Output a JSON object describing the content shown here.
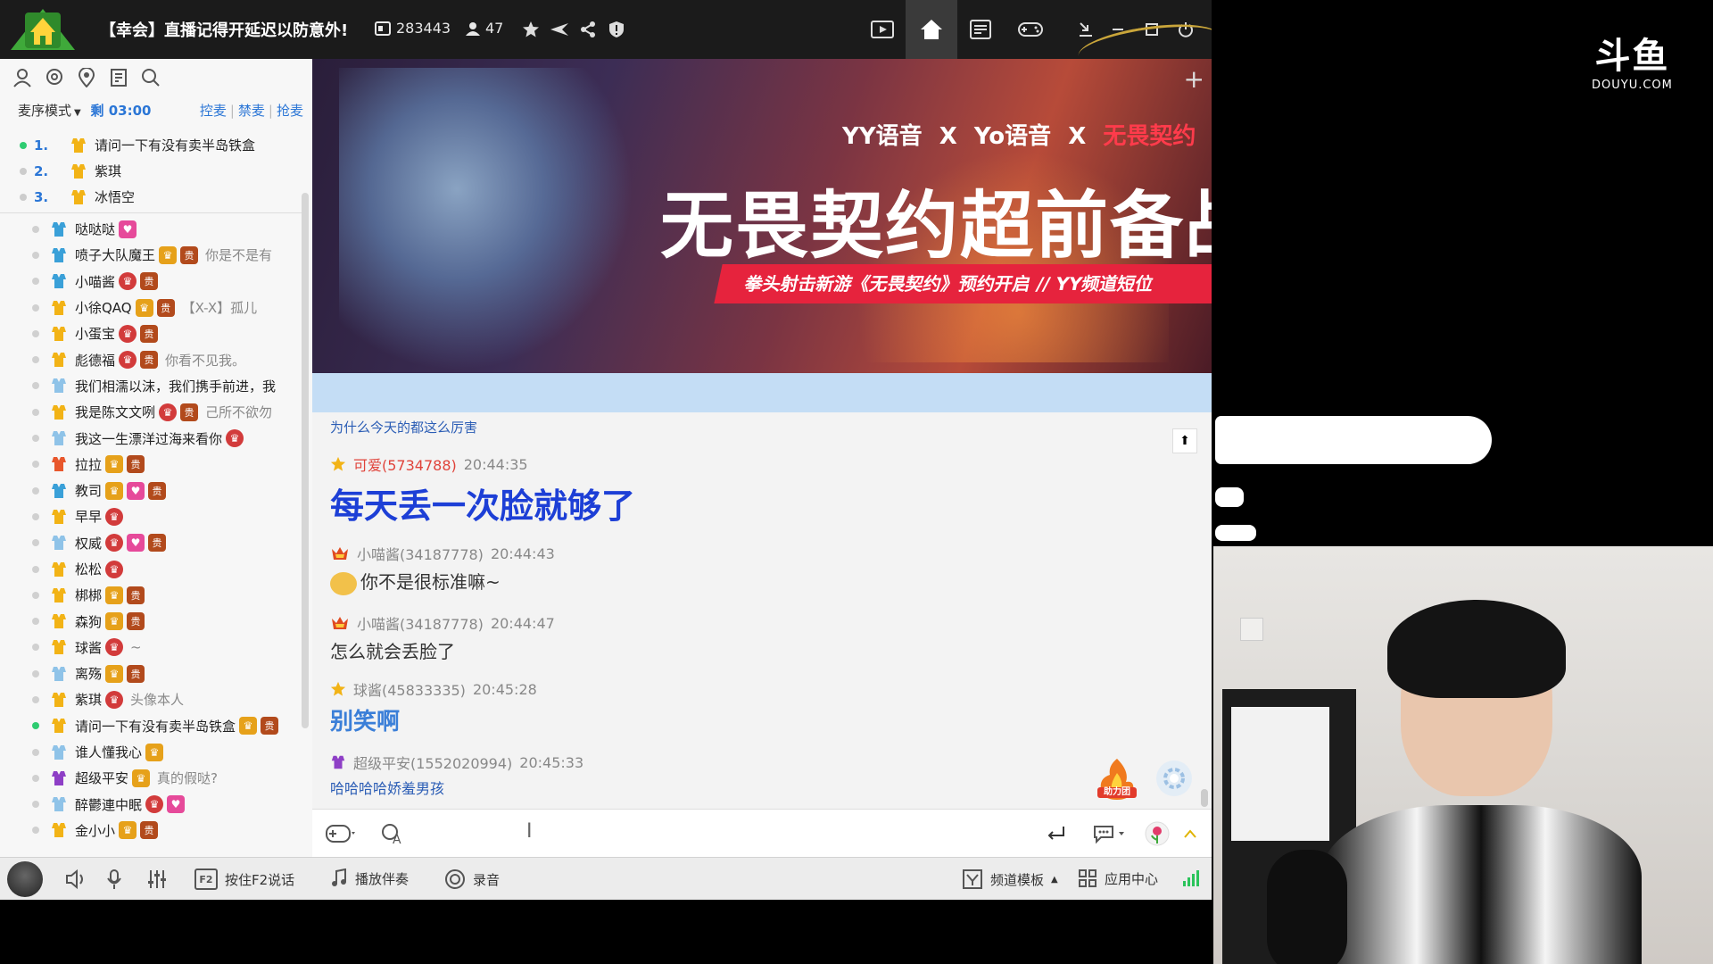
{
  "titlebar": {
    "title": "【幸会】直播记得开延迟以防意外!",
    "channel_id": "283443",
    "online_count": "47"
  },
  "left": {
    "mode_label": "麦序模式",
    "remaining": "剩 03:00",
    "links": [
      "控麦",
      "禁麦",
      "抢麦"
    ],
    "queue": [
      {
        "num": "1.",
        "name": "请问一下有没有卖半岛铁盒",
        "active": true
      },
      {
        "num": "2.",
        "name": "紫琪",
        "active": false
      },
      {
        "num": "3.",
        "name": "冰悟空",
        "active": false
      }
    ],
    "users": [
      {
        "name": "哒哒哒",
        "msg": ""
      },
      {
        "name": "喷子大队魔王",
        "msg": "你是不是有"
      },
      {
        "name": "小喵酱",
        "msg": ""
      },
      {
        "name": "小徐QAQ",
        "msg": "【X-X】孤儿"
      },
      {
        "name": "小蛋宝",
        "msg": ""
      },
      {
        "name": "彪德福",
        "msg": "你看不见我。"
      },
      {
        "name": "我们相濡以沫，我们携手前进，我",
        "msg": ""
      },
      {
        "name": "我是陈文文咧",
        "msg": "己所不欲勿"
      },
      {
        "name": "我这一生漂洋过海来看你",
        "msg": ""
      },
      {
        "name": "拉拉",
        "msg": ""
      },
      {
        "name": "教司",
        "msg": ""
      },
      {
        "name": "早早",
        "msg": ""
      },
      {
        "name": "权威",
        "msg": ""
      },
      {
        "name": "松松",
        "msg": ""
      },
      {
        "name": "梆梆",
        "msg": ""
      },
      {
        "name": "森狗",
        "msg": ""
      },
      {
        "name": "球酱",
        "msg": "~"
      },
      {
        "name": "离殇",
        "msg": ""
      },
      {
        "name": "紫琪",
        "msg": "头像本人"
      },
      {
        "name": "请问一下有没有卖半岛铁盒",
        "msg": ""
      },
      {
        "name": "谁人懂我心",
        "msg": ""
      },
      {
        "name": "超级平安",
        "msg": "真的假哒?"
      },
      {
        "name": "醉鬱連中眠",
        "msg": ""
      },
      {
        "name": "金小小",
        "msg": ""
      }
    ]
  },
  "banner": {
    "sponsor_a": "YY语音",
    "sponsor_x": "X",
    "sponsor_b": "Yo语音",
    "sponsor_c": "无畏契约",
    "title": "无畏契约超前备战",
    "strip": "拳头射击新游《无畏契约》预约开启 // YY频道短位"
  },
  "chat": {
    "top_text": "为什么今天的都这么厉害",
    "messages": [
      {
        "name": "可爱(5734788)",
        "time": "20:44:35",
        "text": "每天丢一次脸就够了",
        "style": "big",
        "name_style": "red"
      },
      {
        "name": "小喵酱(34187778)",
        "time": "20:44:43",
        "text": "你不是很标准嘛~",
        "style": "normal",
        "name_style": ""
      },
      {
        "name": "小喵酱(34187778)",
        "time": "20:44:47",
        "text": "怎么就会丢脸了",
        "style": "normal",
        "name_style": ""
      },
      {
        "name": "球酱(45833335)",
        "time": "20:45:28",
        "text": "别笑啊",
        "style": "blue",
        "name_style": ""
      },
      {
        "name": "超级平安(1552020994)",
        "time": "20:45:33",
        "text": "哈哈哈哈娇羞男孩",
        "style": "small",
        "name_style": ""
      }
    ],
    "assist_label": "助力团"
  },
  "bottom": {
    "f2": "F2",
    "talk": "按住F2说话",
    "music": "播放伴奏",
    "record": "录音",
    "template": "频道模板",
    "apps": "应用中心"
  },
  "overlay": {
    "brand": "斗鱼",
    "brand_sub": "DOUYU.COM"
  },
  "colors": {
    "accent_blue": "#2b76d6",
    "chat_big": "#1d3fd6",
    "online_green": "#2ecc71"
  }
}
